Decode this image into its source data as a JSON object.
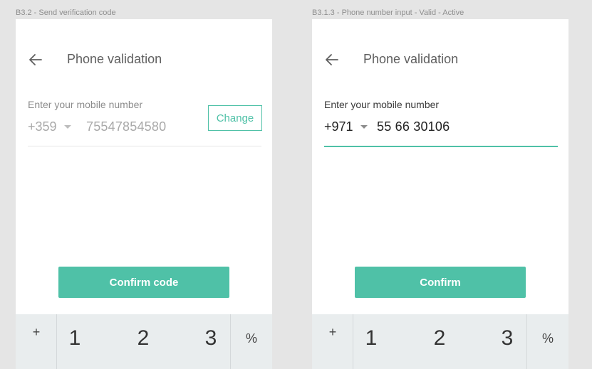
{
  "frames": [
    {
      "label": "B3.2 - Send verification code",
      "header": {
        "title": "Phone validation"
      },
      "field": {
        "label": "Enter your mobile number",
        "country_code": "+359",
        "number": "75547854580",
        "state": "disabled"
      },
      "change_label": "Change",
      "primary_label": "Confirm code"
    },
    {
      "label": "B3.1.3 - Phone number input - Valid - Active",
      "header": {
        "title": "Phone validation"
      },
      "field": {
        "label": "Enter your mobile number",
        "country_code": "+971",
        "number": "55 66 30106",
        "state": "active"
      },
      "primary_label": "Confirm"
    }
  ],
  "keypad": {
    "plus": "+",
    "minus": "-",
    "percent": "%",
    "digits": [
      "1",
      "2",
      "3"
    ]
  },
  "colors": {
    "accent": "#4fc1a7",
    "background": "#e5e5e5",
    "keypad_bg": "#e9edee"
  }
}
